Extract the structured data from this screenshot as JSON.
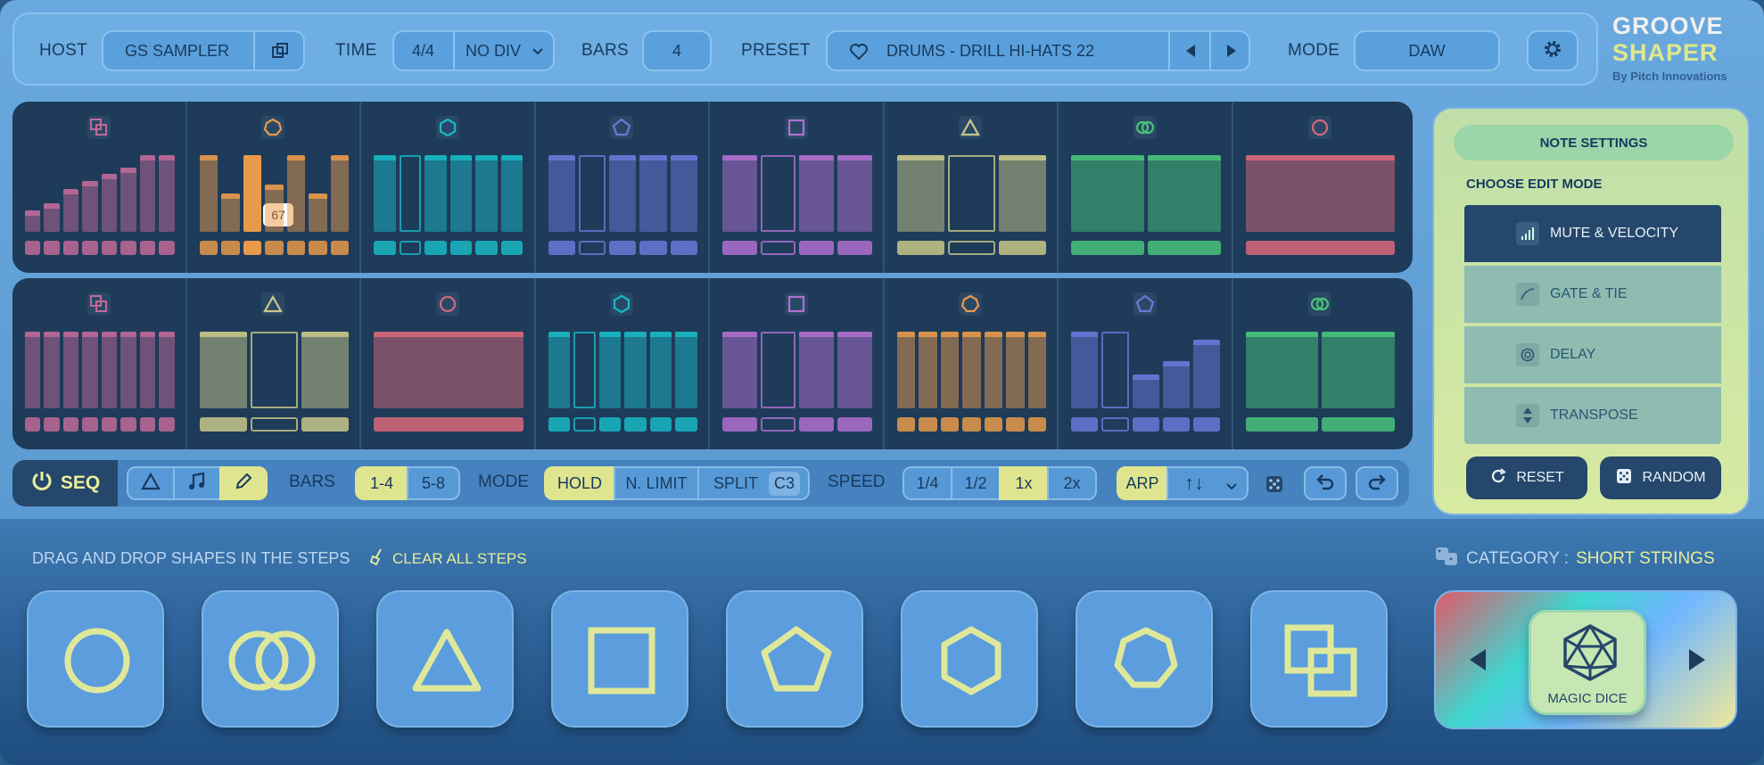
{
  "topbar": {
    "host_label": "HOST",
    "host_value": "GS SAMPLER",
    "time_label": "TIME",
    "time_sig": "4/4",
    "time_div": "NO DIV",
    "bars_label": "BARS",
    "bars_value": "4",
    "preset_label": "PRESET",
    "preset_name": "DRUMS - DRILL HI-HATS 22",
    "mode_label": "MODE",
    "mode_value": "DAW"
  },
  "logo": {
    "line1": "GROOVE",
    "line2": "SHAPER",
    "byline": "By Pitch Innovations"
  },
  "sequencer": {
    "tooltip_value": "67",
    "colors": {
      "pink": "#c06a98",
      "orange": "#e89a4a",
      "teal": "#1ab8c4",
      "blue": "#6a78d8",
      "purple": "#b070d0",
      "olive": "#c8c888",
      "green": "#48c47a",
      "red": "#d86878"
    }
  },
  "controls": {
    "seq_label": "SEQ",
    "bars_label": "BARS",
    "bars_a": "1-4",
    "bars_b": "5-8",
    "mode_label": "MODE",
    "hold": "HOLD",
    "nlimit": "N. LIMIT",
    "split": "SPLIT",
    "split_note": "C3",
    "speed_label": "SPEED",
    "speeds": [
      "1/4",
      "1/2",
      "1x",
      "2x"
    ],
    "arp": "ARP",
    "arp_dir": "↑↓"
  },
  "note_settings": {
    "title": "NOTE SETTINGS",
    "subtitle": "CHOOSE EDIT MODE",
    "modes": [
      "MUTE & VELOCITY",
      "GATE & TIE",
      "DELAY",
      "TRANSPOSE"
    ],
    "reset": "RESET",
    "random": "RANDOM"
  },
  "bottom": {
    "drag_text": "DRAG AND DROP SHAPES IN THE STEPS",
    "clear_text": "CLEAR ALL STEPS",
    "category_label": "CATEGORY : ",
    "category_value": "SHORT STRINGS",
    "dice_label": "MAGIC DICE"
  }
}
